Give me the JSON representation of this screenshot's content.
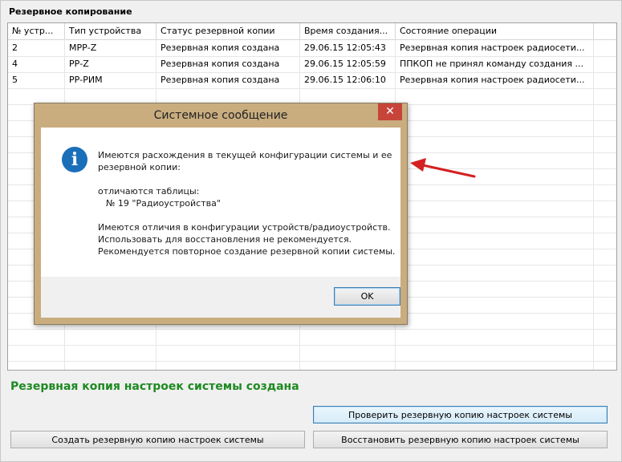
{
  "section_title": "Резервное копирование",
  "table": {
    "columns": [
      "№ устр...",
      "Тип устройства",
      "Статус резервной копии",
      "Время создания...",
      "Состояние операции"
    ],
    "rows": [
      [
        "2",
        "МРР-Z",
        "Резервная копия создана",
        "29.06.15 12:05:43",
        "Резервная копия настроек радиосети..."
      ],
      [
        "4",
        "РР-Z",
        "Резервная копия создана",
        "29.06.15 12:05:59",
        "ППКОП не принял команду создания ..."
      ],
      [
        "5",
        "РР-РИМ",
        "Резервная копия создана",
        "29.06.15 12:06:10",
        "Резервная копия настроек радиосети..."
      ]
    ]
  },
  "dialog": {
    "title": "Системное сообщение",
    "close_label": "✕",
    "lines": [
      "Имеются расхождения в текущей конфигурации системы и ее",
      "резервной копии:",
      "отличаются таблицы:",
      "№ 19 \"Радиоустройства\"",
      "Имеются отличия в конфигурации устройств/радиоустройств.",
      "Использовать для восстановления не рекомендуется.",
      "Рекомендуется повторное создание резервной копии системы."
    ],
    "ok_label": "OK"
  },
  "status_message": "Резервная копия настроек системы создана",
  "buttons": {
    "check": "Проверить резервную копию настроек системы",
    "create": "Создать резервную копию настроек системы",
    "restore": "Восстановить резервную копию настроек системы"
  },
  "colors": {
    "status_green": "#1e8a22",
    "dialog_frame": "#c9ad7f",
    "close_red": "#c7443a",
    "info_blue": "#1a6fb9",
    "arrow_red": "#d42020"
  }
}
